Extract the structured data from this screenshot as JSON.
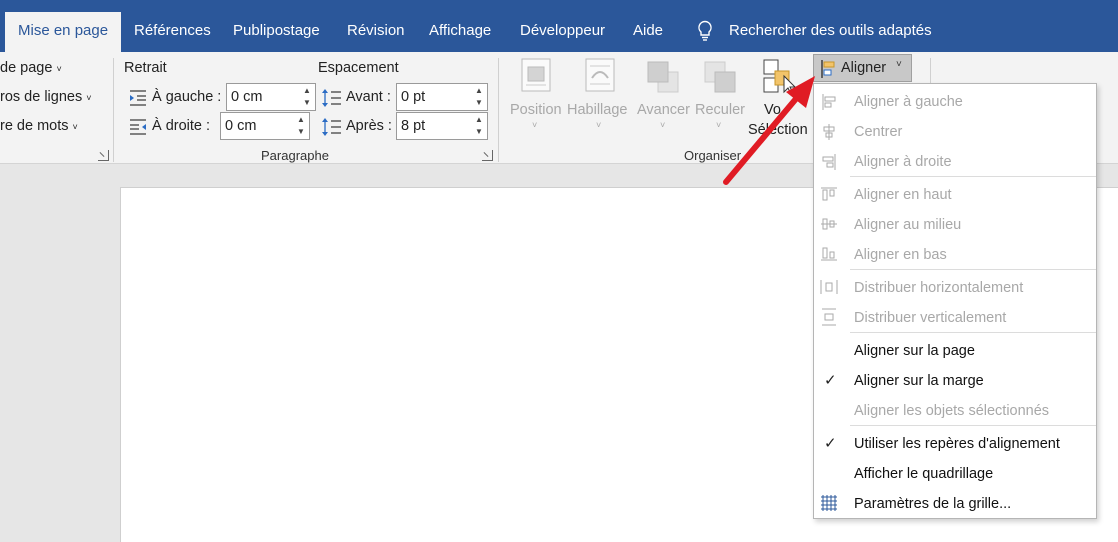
{
  "tabs": {
    "mise_en_page": "Mise en page",
    "references": "Références",
    "publipostage": "Publipostage",
    "revision": "Révision",
    "affichage": "Affichage",
    "developpeur": "Développeur",
    "aide": "Aide",
    "search": "Rechercher des outils adaptés"
  },
  "ribbon": {
    "left": {
      "sauts_de_page": "de page",
      "numeros_lignes": "ros de lignes",
      "coupure_mots": "re de mots"
    },
    "paragraphe": {
      "retrait_title": "Retrait",
      "espacement_title": "Espacement",
      "gauche_label": "À gauche :",
      "gauche_value": "0 cm",
      "droite_label": "À droite :",
      "droite_value": "0 cm",
      "avant_label": "Avant :",
      "avant_value": "0 pt",
      "apres_label": "Après :",
      "apres_value": "8 pt",
      "group_label": "Paragraphe"
    },
    "organiser": {
      "position": "Position",
      "habillage": "Habillage",
      "avancer": "Avancer",
      "reculer": "Reculer",
      "volet_top": "Vo",
      "volet_bottom": "Sélection",
      "aligner": "Aligner",
      "group_label": "Organiser"
    }
  },
  "menu": {
    "items": [
      "Aligner à gauche",
      "Centrer",
      "Aligner à droite",
      "Aligner en haut",
      "Aligner au milieu",
      "Aligner en bas",
      "Distribuer horizontalement",
      "Distribuer verticalement",
      "Aligner sur la page",
      "Aligner sur la marge",
      "Aligner les objets sélectionnés",
      "Utiliser les repères d'alignement",
      "Afficher le quadrillage",
      "Paramètres de la grille..."
    ]
  },
  "colors": {
    "tab_bar": "#2b579a",
    "ribbon_bg": "#f3f3f3",
    "disabled_text": "#a8a8a8",
    "annotation_arrow": "#e01b24"
  }
}
